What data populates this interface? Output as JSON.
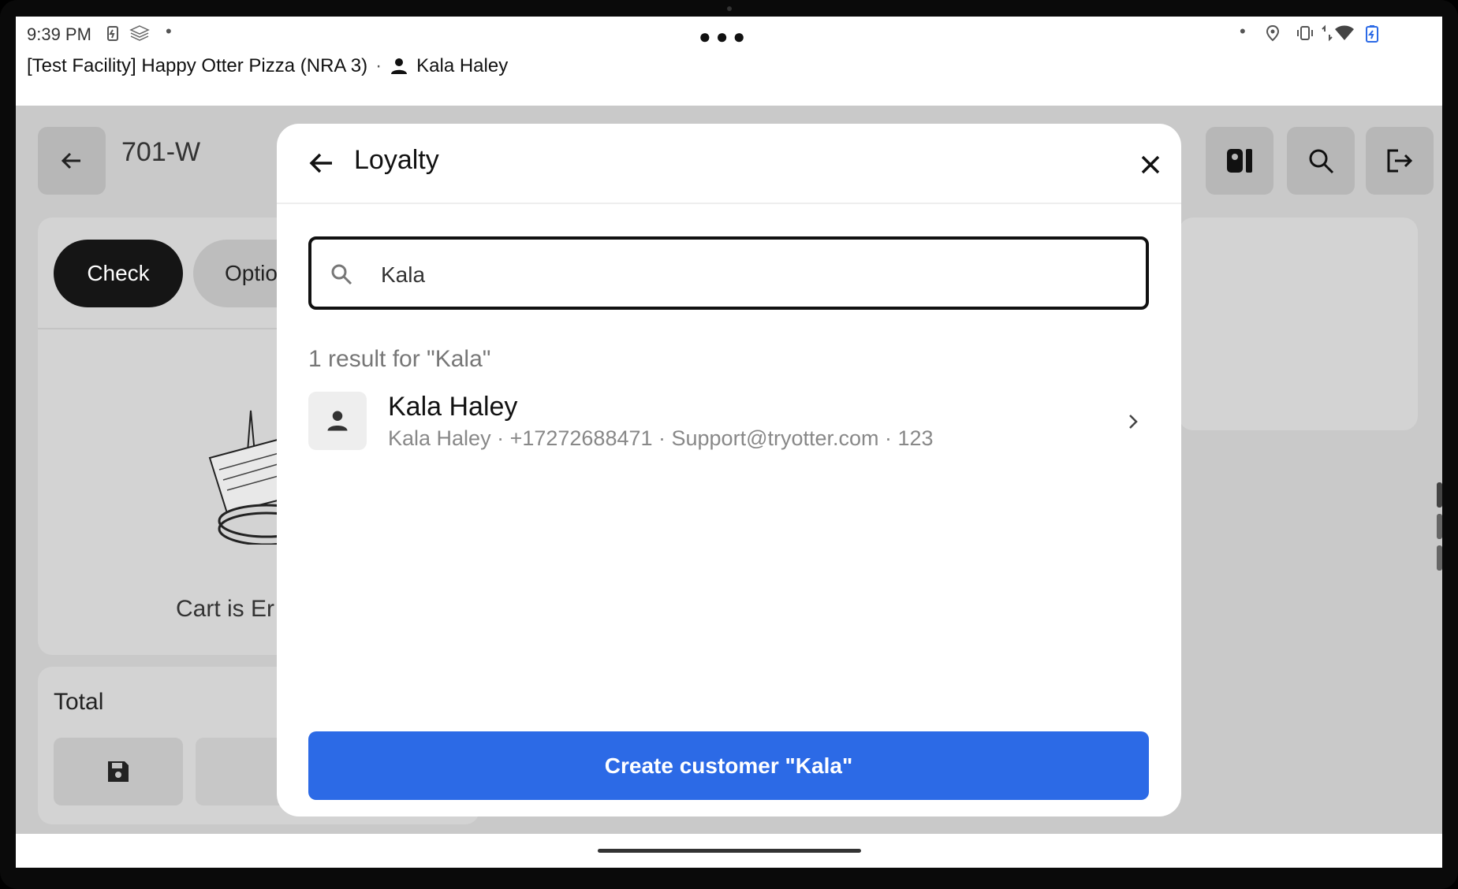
{
  "status_bar": {
    "time": "9:39 PM",
    "left_icons": [
      "battery-saver-icon",
      "stack-icon",
      "dot-icon"
    ],
    "right_icons": [
      "dot-icon",
      "location-icon",
      "vibrate-icon",
      "data-arrows-icon",
      "wifi-icon",
      "battery-icon"
    ]
  },
  "header": {
    "facility": "[Test Facility] Happy Otter Pizza (NRA 3)",
    "separator": "·",
    "user": "Kala Haley"
  },
  "background_app": {
    "order_id": "701-W",
    "tabs": [
      "Check",
      "Optio"
    ],
    "cart_status": "Cart is Er",
    "total_label": "Total"
  },
  "modal": {
    "title": "Loyalty",
    "search": {
      "value": "Kala"
    },
    "result_count": "1 result for \"Kala\"",
    "results": [
      {
        "name": "Kala Haley",
        "details": "Kala Haley · +17272688471 · Support@tryotter.com · 123"
      }
    ],
    "create_button": "Create customer \"Kala\""
  },
  "colors": {
    "primary": "#2c6ae6",
    "overlay": "#c9c9c9",
    "dark_pill": "#151515"
  }
}
